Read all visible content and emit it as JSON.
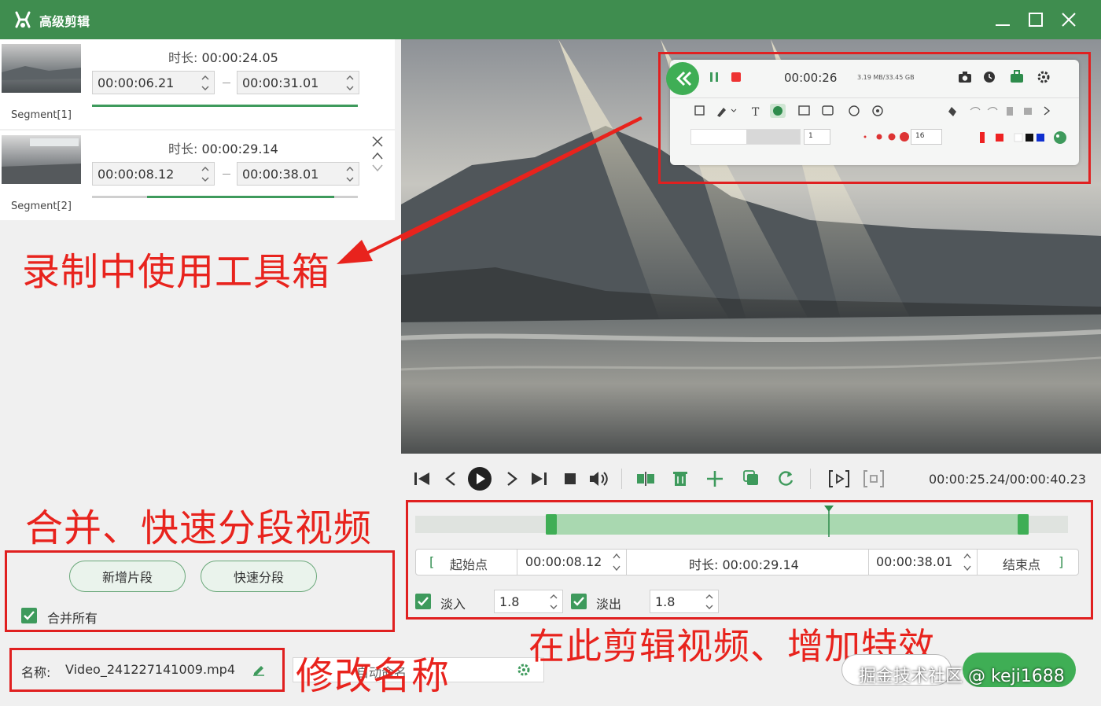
{
  "window": {
    "title": "高级剪辑"
  },
  "segments": [
    {
      "label": "Segment[1]",
      "duration_label": "时长:",
      "duration": "00:00:24.05",
      "start": "00:00:06.21",
      "end": "00:00:31.01"
    },
    {
      "label": "Segment[2]",
      "duration_label": "时长:",
      "duration": "00:00:29.14",
      "start": "00:00:08.12",
      "end": "00:00:38.01"
    }
  ],
  "annotations": {
    "toolbox": "录制中使用工具箱",
    "merge": "合并、快速分段视频",
    "rename": "修改名称",
    "edit": "在此剪辑视频、增加特效"
  },
  "buttons": {
    "add_segment": "新增片段",
    "quick_split": "快速分段"
  },
  "merge_all": {
    "label": "合并所有",
    "checked": true
  },
  "name_field": {
    "label": "名称:",
    "value": "Video_241227141009.mp4"
  },
  "output_field": {
    "value": "自动命名"
  },
  "toolbar_overlay": {
    "time": "00:00:26",
    "size": "3.19 MB/33.45 GB",
    "field1": "1",
    "field2": "16"
  },
  "player": {
    "timecode": "00:00:25.24/00:00:40.23"
  },
  "editor": {
    "start_label": "起始点",
    "start_value": "00:00:08.12",
    "duration_label": "时长:",
    "duration_value": "00:00:29.14",
    "end_value": "00:00:38.01",
    "end_label": "结束点",
    "fade_in_label": "淡入",
    "fade_in_value": "1.8",
    "fade_out_label": "淡出",
    "fade_out_value": "1.8"
  },
  "watermark": "掘金技术社区 @ keji1688",
  "colors": {
    "brand": "#3f8d4f",
    "accent": "#3e9a5c",
    "annotation": "#e8231d"
  }
}
